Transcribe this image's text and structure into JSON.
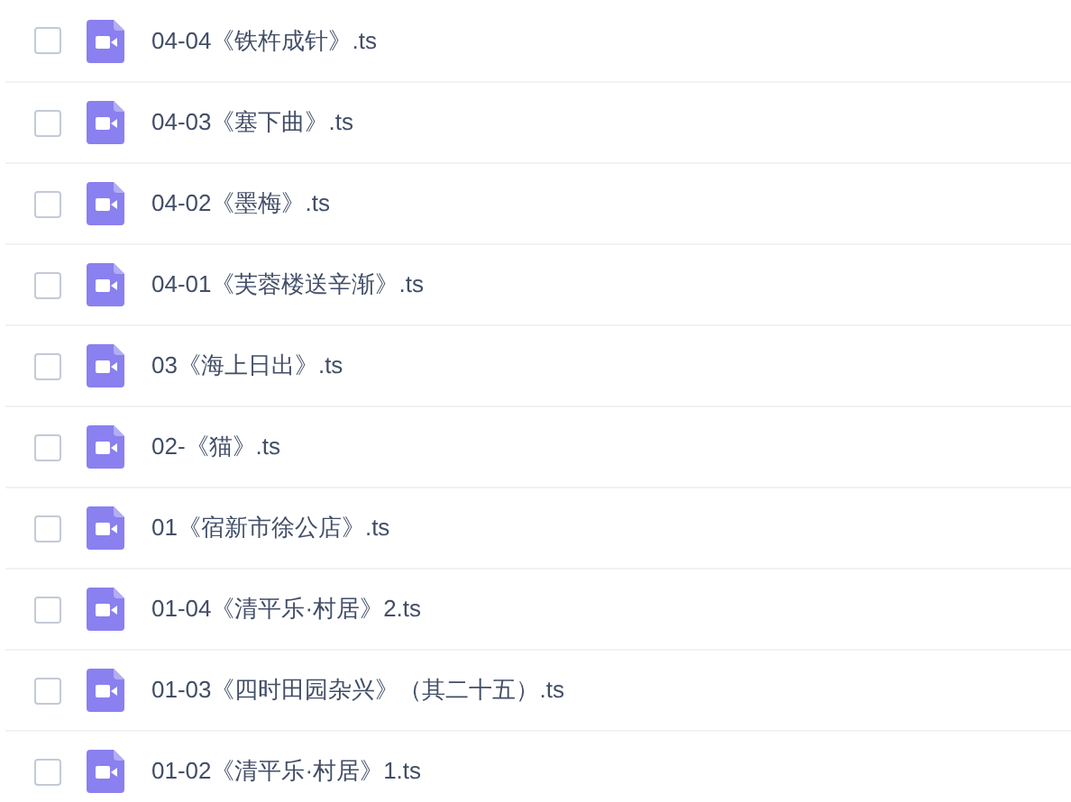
{
  "files": [
    {
      "name": "04-04《铁杵成针》.ts",
      "checked": false
    },
    {
      "name": "04-03《塞下曲》.ts",
      "checked": false
    },
    {
      "name": "04-02《墨梅》.ts",
      "checked": false
    },
    {
      "name": "04-01《芙蓉楼送辛渐》.ts",
      "checked": false
    },
    {
      "name": "03《海上日出》.ts",
      "checked": false
    },
    {
      "name": "02-《猫》.ts",
      "checked": false
    },
    {
      "name": "01《宿新市徐公店》.ts",
      "checked": false
    },
    {
      "name": "01-04《清平乐·村居》2.ts",
      "checked": false
    },
    {
      "name": "01-03《四时田园杂兴》（其二十五）.ts",
      "checked": false
    },
    {
      "name": "01-02《清平乐·村居》1.ts",
      "checked": false
    }
  ]
}
